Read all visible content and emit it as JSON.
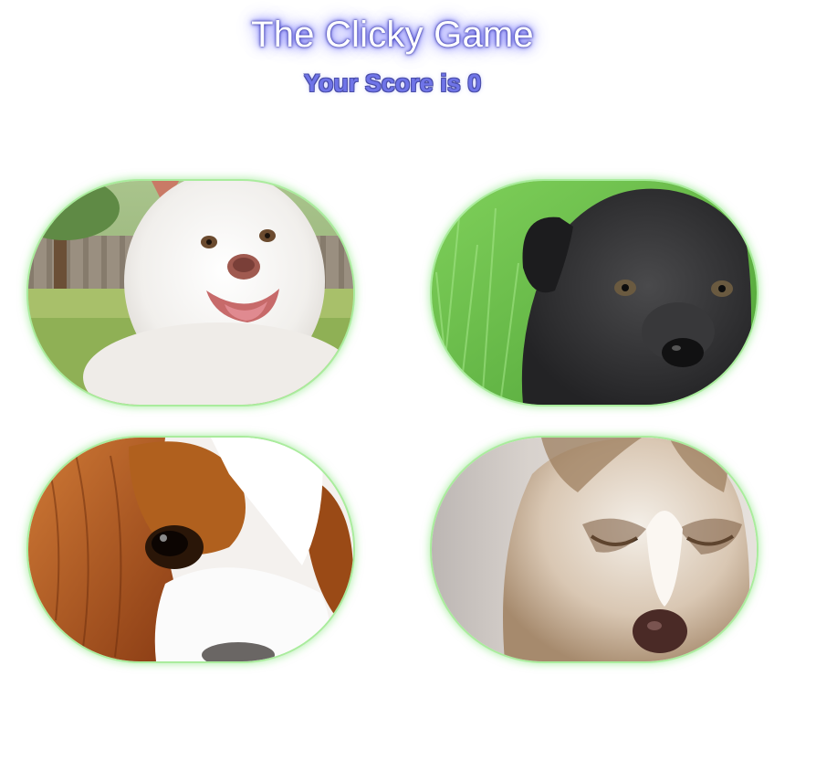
{
  "header": {
    "title": "The Clicky Game",
    "score_text": "Your Score is 0"
  },
  "cards": [
    {
      "subject": "white fluffy puppy on lawn"
    },
    {
      "subject": "black labrador puppy in grass"
    },
    {
      "subject": "cavalier king charles spaniel close-up"
    },
    {
      "subject": "husky puppy close-up"
    }
  ],
  "colors": {
    "card_glow": "#8ae678",
    "score_fill": "#6f74e8",
    "title_glow": "#6a6aff"
  }
}
